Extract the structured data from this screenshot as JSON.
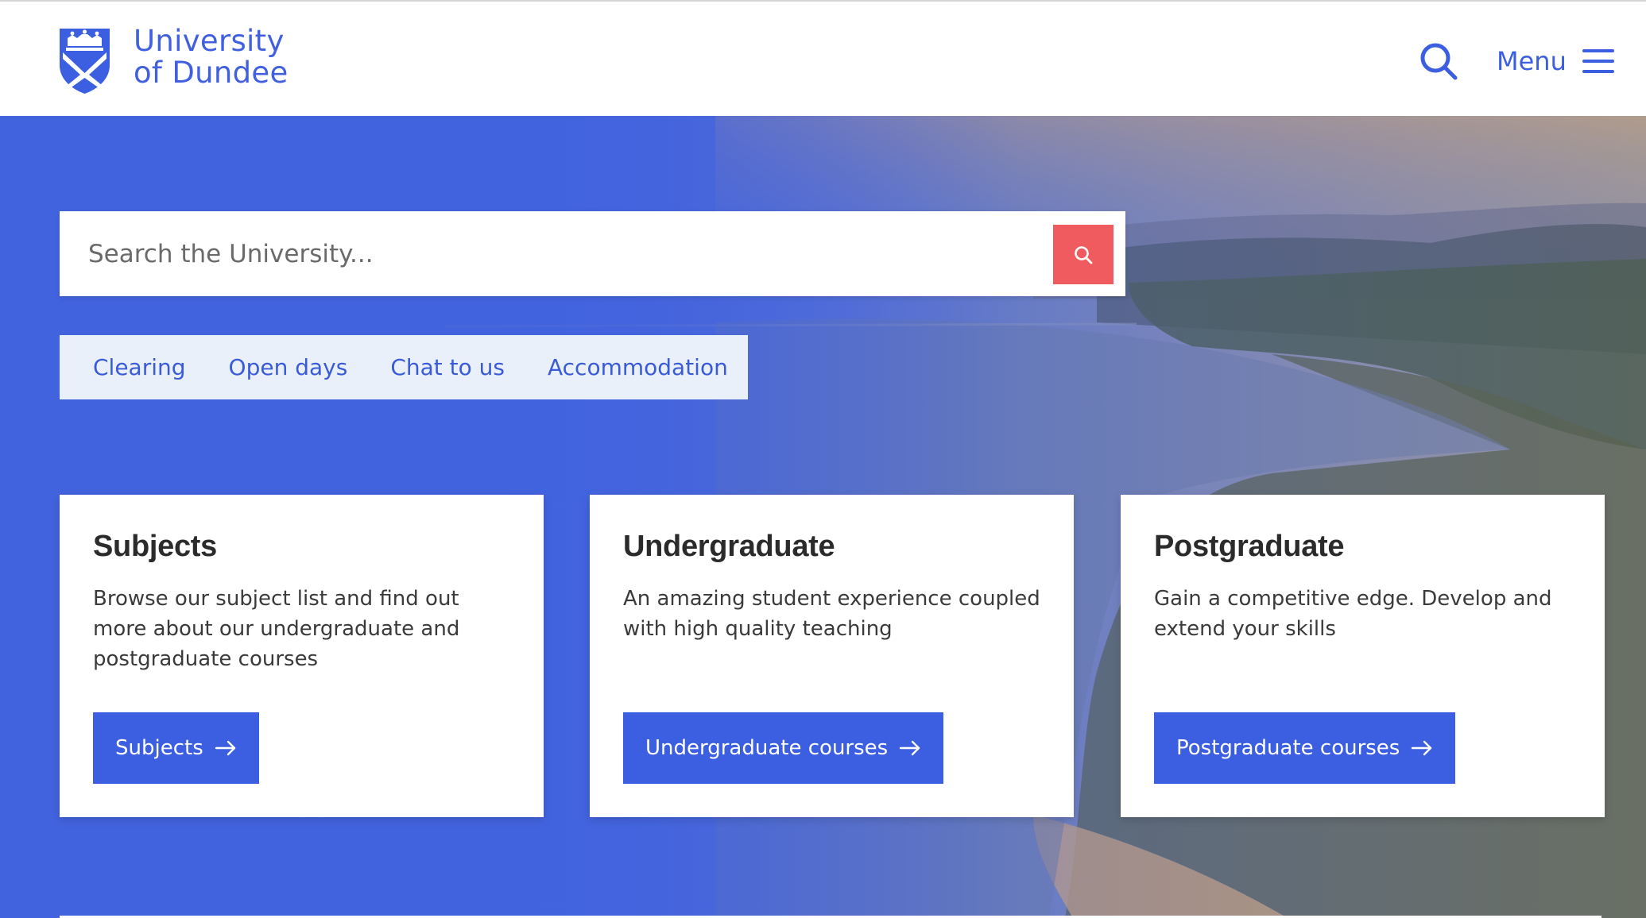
{
  "header": {
    "logo": {
      "line1": "University",
      "line2": "of Dundee",
      "icon": "university-crest-icon"
    },
    "search_icon": "search-icon",
    "menu_label": "Menu",
    "menu_icon": "hamburger-icon"
  },
  "search": {
    "placeholder": "Search the University...",
    "submit_icon": "search-icon"
  },
  "quick_links": [
    {
      "label": "Clearing"
    },
    {
      "label": "Open days"
    },
    {
      "label": "Chat to us"
    },
    {
      "label": "Accommodation"
    }
  ],
  "cards": [
    {
      "title": "Subjects",
      "description": "Browse our subject list and find out more about our undergraduate and postgraduate courses",
      "button_label": "Subjects",
      "button_icon": "arrow-right-icon"
    },
    {
      "title": "Undergraduate",
      "description": "An amazing student experience coupled with high quality teaching",
      "button_label": "Undergraduate courses",
      "button_icon": "arrow-right-icon"
    },
    {
      "title": "Postgraduate",
      "description": "Gain a competitive edge. Develop and extend your skills",
      "button_label": "Postgraduate courses",
      "button_icon": "arrow-right-icon"
    }
  ],
  "colors": {
    "brand_blue": "#3b5fe0",
    "hero_blue": "#4263de",
    "search_button": "#ef5b5f",
    "quick_links_bg": "#eaf0fa"
  }
}
